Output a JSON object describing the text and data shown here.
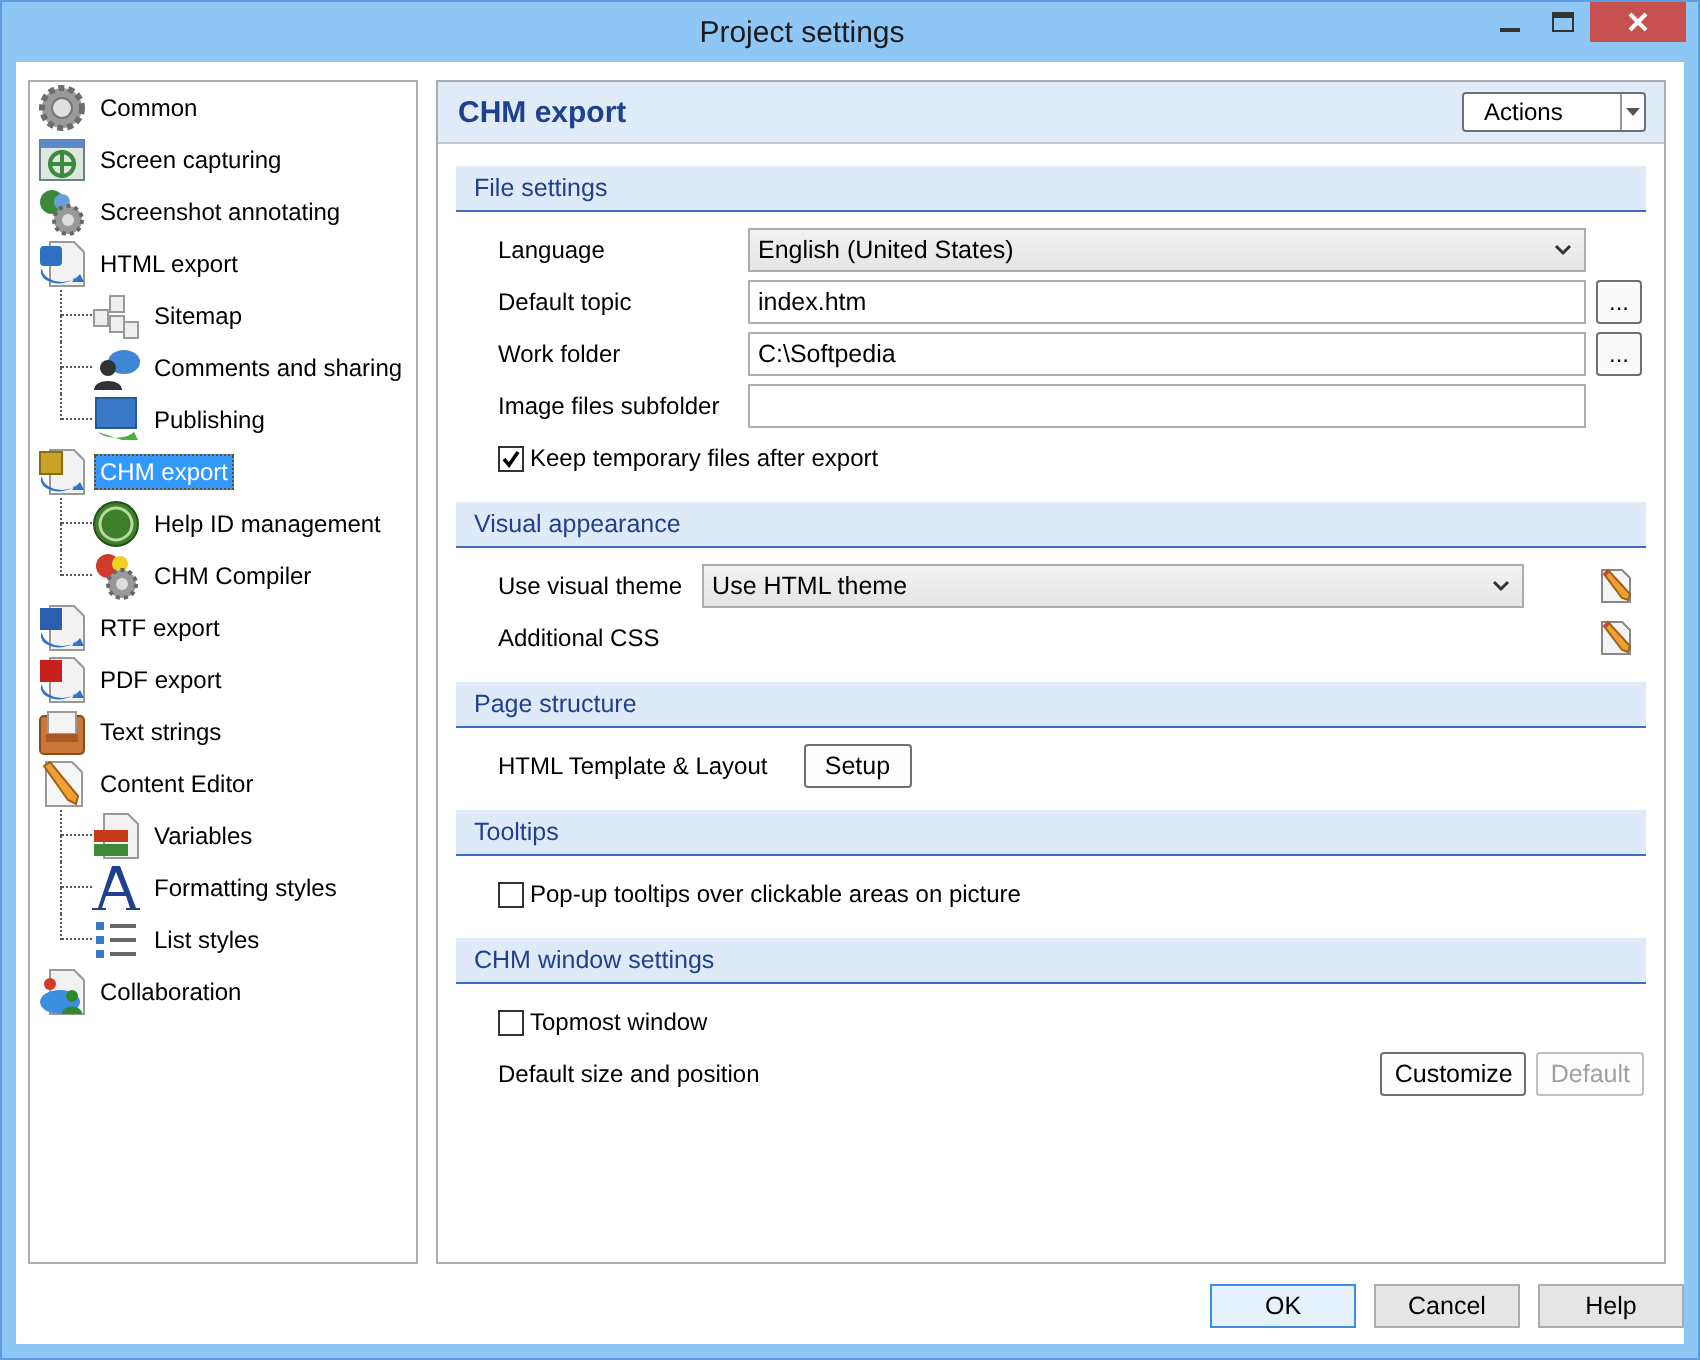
{
  "window": {
    "title": "Project settings"
  },
  "sidebar": {
    "items": [
      {
        "label": "Common",
        "selected": false
      },
      {
        "label": "Screen capturing",
        "selected": false
      },
      {
        "label": "Screenshot annotating",
        "selected": false
      },
      {
        "label": "HTML export",
        "selected": false,
        "children": [
          {
            "label": "Sitemap",
            "selected": false
          },
          {
            "label": "Comments and sharing",
            "selected": false
          },
          {
            "label": "Publishing",
            "selected": false
          }
        ]
      },
      {
        "label": "CHM export",
        "selected": true,
        "children": [
          {
            "label": "Help ID management",
            "selected": false
          },
          {
            "label": "CHM Compiler",
            "selected": false
          }
        ]
      },
      {
        "label": "RTF export",
        "selected": false
      },
      {
        "label": "PDF export",
        "selected": false
      },
      {
        "label": "Text strings",
        "selected": false
      },
      {
        "label": "Content Editor",
        "selected": false,
        "children": [
          {
            "label": "Variables",
            "selected": false
          },
          {
            "label": "Formatting styles",
            "selected": false
          },
          {
            "label": "List styles",
            "selected": false
          }
        ]
      },
      {
        "label": "Collaboration",
        "selected": false
      }
    ]
  },
  "panel": {
    "title": "CHM export",
    "actions_button": "Actions",
    "sections": [
      {
        "title": "File settings",
        "rows": [
          {
            "kind": "select",
            "label": "Language",
            "value": "English (United States)",
            "edit": false
          },
          {
            "kind": "field",
            "label": "Default topic",
            "value": "index.htm",
            "browse": "..."
          },
          {
            "kind": "field",
            "label": "Work folder",
            "value": "C:\\Softpedia",
            "browse": "..."
          },
          {
            "kind": "field",
            "label": "Image files subfolder"
          },
          {
            "kind": "checkbox",
            "label": "Keep temporary files after export",
            "checked": true
          }
        ]
      },
      {
        "title": "Visual appearance",
        "rows": [
          {
            "kind": "select",
            "label": "Use visual theme",
            "value": "Use HTML theme",
            "edit": true
          },
          {
            "kind": "edit",
            "label": "Additional CSS"
          }
        ]
      },
      {
        "title": "Page structure",
        "rows": [
          {
            "kind": "button",
            "label": "HTML Template & Layout",
            "button": "Setup"
          }
        ]
      },
      {
        "title": "Tooltips",
        "rows": [
          {
            "kind": "checkbox",
            "label": "Pop-up tooltips over clickable areas on picture",
            "checked": false
          }
        ]
      },
      {
        "title": "CHM window settings",
        "rows": [
          {
            "kind": "checkbox",
            "label": "Topmost window",
            "checked": false
          },
          {
            "kind": "buttons",
            "label": "Default size and position",
            "buttons": [
              {
                "label": "Customize",
                "disabled": false
              },
              {
                "label": "Default",
                "disabled": true
              }
            ]
          }
        ]
      }
    ]
  },
  "buttons": [
    {
      "label": "OK",
      "focused": true
    },
    {
      "label": "Cancel",
      "focused": false
    },
    {
      "label": "Help",
      "focused": false
    }
  ]
}
